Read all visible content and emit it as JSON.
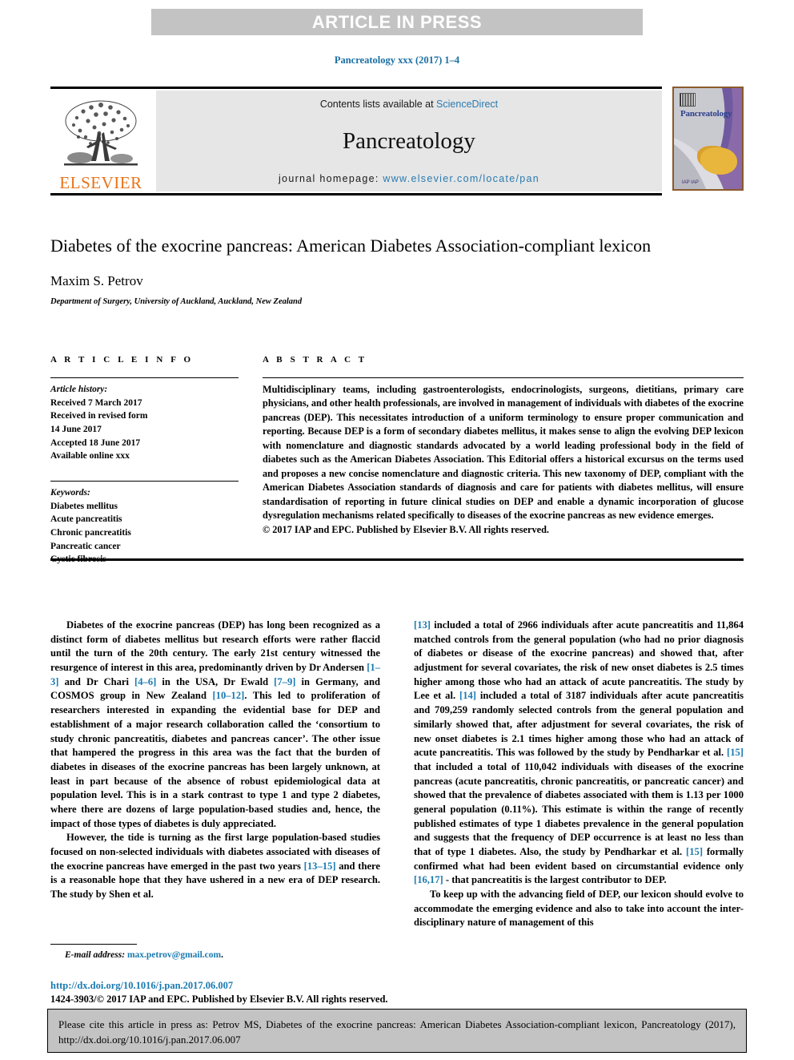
{
  "banner": {
    "text": "ARTICLE IN PRESS"
  },
  "running_head": "Pancreatology xxx (2017) 1–4",
  "masthead": {
    "publisher_word": "ELSEVIER",
    "contents_prefix": "Contents lists available at ",
    "contents_link": "ScienceDirect",
    "journal_name": "Pancreatology",
    "homepage_prefix": "journal homepage: ",
    "homepage_url": "www.elsevier.com/locate/pan",
    "cover": {
      "title": "Pancreatology",
      "footer_marks": "IAP  IAP"
    }
  },
  "article": {
    "title": "Diabetes of the exocrine pancreas: American Diabetes Association-compliant lexicon",
    "author": "Maxim S. Petrov",
    "affiliation": "Department of Surgery, University of Auckland, Auckland, New Zealand"
  },
  "info": {
    "heading": "A R T I C L E   I N F O",
    "history_label": "Article history:",
    "history": [
      "Received 7 March 2017",
      "Received in revised form",
      "14 June 2017",
      "Accepted 18 June 2017",
      "Available online xxx"
    ],
    "keywords_label": "Keywords:",
    "keywords": [
      "Diabetes mellitus",
      "Acute pancreatitis",
      "Chronic pancreatitis",
      "Pancreatic cancer",
      "Cystic fibrosis"
    ]
  },
  "abstract": {
    "heading": "A B S T R A C T",
    "body": "Multidisciplinary teams, including gastroenterologists, endocrinologists, surgeons, dietitians, primary care physicians, and other health professionals, are involved in management of individuals with diabetes of the exocrine pancreas (DEP). This necessitates introduction of a uniform terminology to ensure proper communication and reporting. Because DEP is a form of secondary diabetes mellitus, it makes sense to align the evolving DEP lexicon with nomenclature and diagnostic standards advocated by a world leading professional body in the field of diabetes such as the American Diabetes Association. This Editorial offers a historical excursus on the terms used and proposes a new concise nomenclature and diagnostic criteria. This new taxonomy of DEP, compliant with the American Diabetes Association standards of diagnosis and care for patients with diabetes mellitus, will ensure standardisation of reporting in future clinical studies on DEP and enable a dynamic incorporation of glucose dysregulation mechanisms related specifically to diseases of the exocrine pancreas as new evidence emerges.",
    "copyright": "© 2017 IAP and EPC. Published by Elsevier B.V. All rights reserved."
  },
  "body": {
    "left": [
      {
        "indent": true,
        "segments": [
          {
            "t": "Diabetes of the exocrine pancreas (DEP) has long been recognized as a distinct form of diabetes mellitus but research efforts were rather flaccid until the turn of the 20th century. The early 21st century witnessed the resurgence of interest in this area, predominantly driven by Dr Andersen ",
            "ref": false
          },
          {
            "t": "[1–3]",
            "ref": true
          },
          {
            "t": " and Dr Chari ",
            "ref": false
          },
          {
            "t": "[4–6]",
            "ref": true
          },
          {
            "t": " in the USA, Dr Ewald ",
            "ref": false
          },
          {
            "t": "[7–9]",
            "ref": true
          },
          {
            "t": " in Germany, and COSMOS group in New Zealand ",
            "ref": false
          },
          {
            "t": "[10–12]",
            "ref": true
          },
          {
            "t": ". This led to proliferation of researchers interested in expanding the evidential base for DEP and establishment of a major research collaboration called the ‘consortium to study chronic pancreatitis, diabetes and pancreas cancer’. The other issue that hampered the progress in this area was the fact that the burden of diabetes in diseases of the exocrine pancreas has been largely unknown, at least in part because of the absence of robust epidemiological data at population level. This is in a stark contrast to type 1 and type 2 diabetes, where there are dozens of large population-based studies and, hence, the impact of those types of diabetes is duly appreciated.",
            "ref": false
          }
        ]
      },
      {
        "indent": true,
        "segments": [
          {
            "t": "However, the tide is turning as the first large population-based studies focused on non-selected individuals with diabetes associated with diseases of the exocrine pancreas have emerged in the past two years ",
            "ref": false
          },
          {
            "t": "[13–15]",
            "ref": true
          },
          {
            "t": " and there is a reasonable hope that they have ushered in a new era of DEP research. The study by Shen et al.",
            "ref": false
          }
        ]
      }
    ],
    "right": [
      {
        "indent": false,
        "segments": [
          {
            "t": "[13]",
            "ref": true
          },
          {
            "t": " included a total of 2966 individuals after acute pancreatitis and 11,864 matched controls from the general population (who had no prior diagnosis of diabetes or disease of the exocrine pancreas) and showed that, after adjustment for several covariates, the risk of new onset diabetes is 2.5 times higher among those who had an attack of acute pancreatitis. The study by Lee et al. ",
            "ref": false
          },
          {
            "t": "[14]",
            "ref": true
          },
          {
            "t": " included a total of 3187 individuals after acute pancreatitis and 709,259 randomly selected controls from the general population and similarly showed that, after adjustment for several covariates, the risk of new onset diabetes is 2.1 times higher among those who had an attack of acute pancreatitis. This was followed by the study by Pendharkar et al. ",
            "ref": false
          },
          {
            "t": "[15]",
            "ref": true
          },
          {
            "t": " that included a total of 110,042 individuals with diseases of the exocrine pancreas (acute pancreatitis, chronic pancreatitis, or pancreatic cancer) and showed that the prevalence of diabetes associated with them is 1.13 per 1000 general population (0.11%). This estimate is within the range of recently published estimates of type 1 diabetes prevalence in the general population and suggests that the frequency of DEP occurrence is at least no less than that of type 1 diabetes. Also, the study by Pendharkar et al. ",
            "ref": false
          },
          {
            "t": "[15]",
            "ref": true
          },
          {
            "t": " formally confirmed what had been evident based on circumstantial evidence only ",
            "ref": false
          },
          {
            "t": "[16,17]",
            "ref": true
          },
          {
            "t": " - that pancreatitis is the largest contributor to DEP.",
            "ref": false
          }
        ]
      },
      {
        "indent": true,
        "segments": [
          {
            "t": "To keep up with the advancing field of DEP, our lexicon should evolve to accommodate the emerging evidence and also to take into account the inter-disciplinary nature of management of this",
            "ref": false
          }
        ]
      }
    ]
  },
  "footnote": {
    "label": "E-mail address:",
    "email": "max.petrov@gmail.com",
    "trailing": "."
  },
  "doi": {
    "url": "http://dx.doi.org/10.1016/j.pan.2017.06.007",
    "issn_line": "1424-3903/© 2017 IAP and EPC. Published by Elsevier B.V. All rights reserved."
  },
  "cite_box": {
    "text": "Please cite this article in press as: Petrov MS, Diabetes of the exocrine pancreas: American Diabetes Association-compliant lexicon, Pancreatology (2017), http://dx.doi.org/10.1016/j.pan.2017.06.007"
  },
  "colors": {
    "link": "#1a7ab0",
    "banner_bg": "#c3c3c3",
    "masthead_bg": "#e6e6e6",
    "elsevier_orange": "#e8731a"
  }
}
